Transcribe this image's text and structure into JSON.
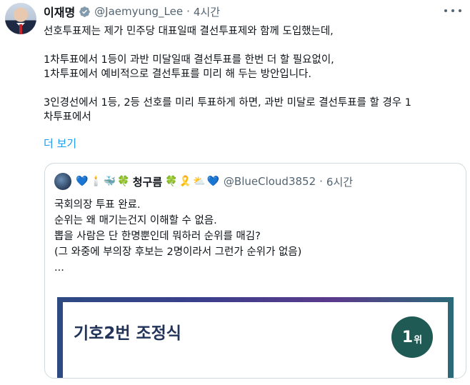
{
  "tweet": {
    "author_name": "이재명",
    "handle": "@Jaemyung_Lee",
    "separator": "·",
    "time": "4시간",
    "lines": [
      "선호투표제는 제가 민주당 대표일때 결선투표제와 함께 도입했는데,",
      "1차투표에서 1등이 과반 미달일때 결선투표를 한번 더 할 필요없이,",
      "1차투표에서 예비적으로 결선투표를 미리 해 두는 방안입니다.",
      "3인경선에서 1등, 2등 선호를 미리 투표하게 하면, 과반 미달로 결선투표를 할 경우 1",
      "차투표에서"
    ],
    "show_more": "더 보기"
  },
  "quote": {
    "emojis_before": [
      "💙",
      "🕯️",
      "🐳",
      "🍀"
    ],
    "name": "청구름",
    "emojis_after": [
      "🍀",
      "🎗️",
      "⛅",
      "💙"
    ],
    "handle": "@BlueCloud3852",
    "separator": "·",
    "time": "6시간",
    "lines": [
      "국회의장 투표 완료.",
      "순위는 왜 매기는건지 이해할 수 없음.",
      "뽑을 사람은 단 한명뿐인데 뭐하러 순위를 매김?",
      "(그 와중에 부의장 후보는 2명이라서 그런가 순위가 없음)",
      "..."
    ],
    "image": {
      "candidate": "기호2번 조정식",
      "rank_number": "1",
      "rank_unit": "위"
    }
  },
  "colors": {
    "accent": "#1d9bf0",
    "secondary_text": "#536471",
    "border": "#cfd9de",
    "badge": "#1f5b54"
  },
  "icons": [
    "verified-badge-icon",
    "more-options-icon"
  ]
}
